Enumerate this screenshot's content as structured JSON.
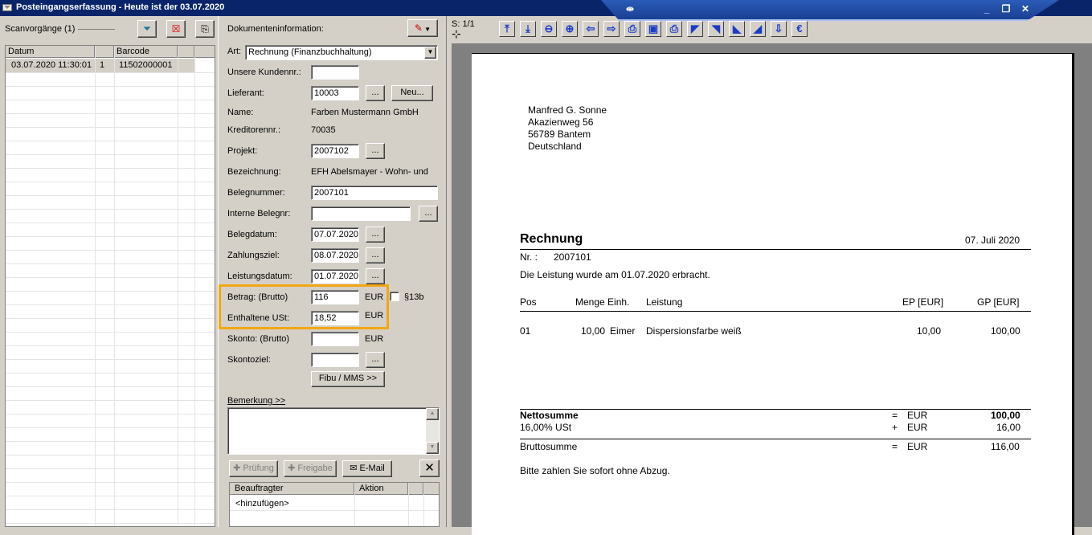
{
  "window": {
    "title": "Posteingangserfassung - Heute ist der 03.07.2020"
  },
  "scan": {
    "label": "Scanvorgänge (1)",
    "columns": [
      "Datum",
      "",
      "Barcode"
    ],
    "rows": [
      {
        "datum": "03.07.2020 11:30:01",
        "nr": "1",
        "barcode": "11502000001"
      }
    ]
  },
  "doc": {
    "header": "Dokumenteninformation:",
    "art_label": "Art:",
    "art_value": "Rechnung (Finanzbuchhaltung)",
    "kundennr_label": "Unsere Kundennr.:",
    "kundennr_value": "",
    "lieferant_label": "Lieferant:",
    "lieferant_value": "10003",
    "dots": "...",
    "neu_label": "Neu...",
    "name_label": "Name:",
    "name_value": "Farben Mustermann GmbH",
    "kreditor_label": "Kreditorennr.:",
    "kreditor_value": "70035",
    "projekt_label": "Projekt:",
    "projekt_value": "2007102",
    "bezeichnung_label": "Bezeichnung:",
    "bezeichnung_value": "EFH Abelsmayer - Wohn- und",
    "belegnummer_label": "Belegnummer:",
    "belegnummer_value": "2007101",
    "interne_label": "Interne Belegnr:",
    "interne_value": "",
    "belegdatum_label": "Belegdatum:",
    "belegdatum_value": "07.07.2020",
    "zahlungsziel_label": "Zahlungsziel:",
    "zahlungsziel_value": "08.07.2020",
    "leistungsdatum_label": "Leistungsdatum:",
    "leistungsdatum_value": "01.07.2020",
    "betrag_label": "Betrag: (Brutto)",
    "betrag_value": "116",
    "currency": "EUR",
    "p13b_label": "§13b",
    "ust_label": "Enthaltene USt:",
    "ust_value": "18,52",
    "skonto_label": "Skonto: (Brutto)",
    "skonto_value": "",
    "skontoziel_label": "Skontoziel:",
    "skontoziel_value": "",
    "fibu_label": "Fibu / MMS >>",
    "bemerkung_label": "Bemerkung >>",
    "bemerkung_value": "",
    "pruefung_label": "Prüfung",
    "freigabe_label": "Freigabe",
    "email_label": "E-Mail",
    "beauftragter_label": "Beauftragter",
    "aktion_label": "Aktion",
    "hinzufuegen_label": "<hinzufügen>"
  },
  "viewer": {
    "page_label": "S: 1/1"
  },
  "invoice": {
    "addr1": "Manfred G. Sonne",
    "addr2": "Akazienweg 56",
    "addr3": "56789 Bantem",
    "addr4": "Deutschland",
    "title": "Rechnung",
    "date": "07. Juli 2020",
    "nr_label": "Nr. :",
    "nr_value": "2007101",
    "leistung_text": "Die Leistung wurde am 01.07.2020 erbracht.",
    "col_pos": "Pos",
    "col_menge": "Menge Einh.",
    "col_leistung": "Leistung",
    "col_ep": "EP [EUR]",
    "col_gp": "GP [EUR]",
    "item_pos": "01",
    "item_menge": "10,00",
    "item_einh": "Eimer",
    "item_leistung": "Dispersionsfarbe weiß",
    "item_ep": "10,00",
    "item_gp": "100,00",
    "netto_label": "Nettosumme",
    "netto_op": "=",
    "netto_cur": "EUR",
    "netto_value": "100,00",
    "ust_label": "16,00% USt",
    "ust_op": "+",
    "ust_cur": "EUR",
    "ust_value": "16,00",
    "brutto_label": "Bruttosumme",
    "brutto_op": "=",
    "brutto_cur": "EUR",
    "brutto_value": "116,00",
    "zahlen_text": "Bitte zahlen Sie sofort ohne Abzug."
  }
}
